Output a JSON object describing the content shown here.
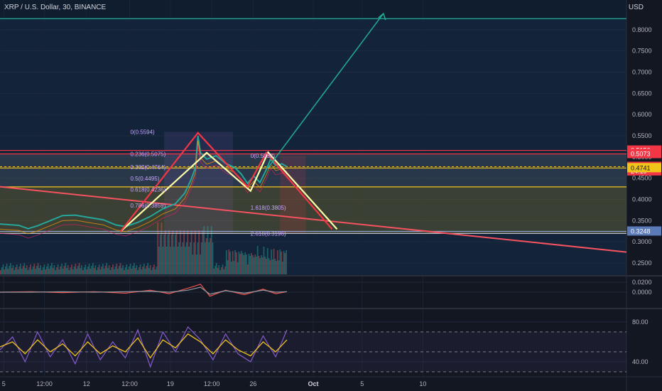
{
  "header": {
    "symbol_line": "XRP / U.S. Dollar, 30, BINANCE",
    "currency": "USD"
  },
  "chart_data": [
    {
      "type": "line",
      "title": "XRP / U.S. Dollar, 30, BINANCE",
      "ylabel": "USD",
      "ylim": [
        0.22,
        0.87
      ],
      "yticks": [
        "0.2500",
        "0.3000",
        "0.3500",
        "0.4000",
        "0.4500",
        "0.5000",
        "0.5500",
        "0.6000",
        "0.6500",
        "0.7000",
        "0.7500",
        "0.8000"
      ],
      "xticks": [
        "5",
        "12:00",
        "12",
        "12:00",
        "19",
        "12:00",
        "26",
        "Oct",
        "5",
        "10"
      ],
      "grid": true,
      "price_labels": [
        {
          "text": "0.5156",
          "value": 0.5156,
          "color": "#f23645"
        },
        {
          "text": "0.5073",
          "value": 0.5073,
          "color": "#f23645"
        },
        {
          "text": "0.4772",
          "value": 0.4772,
          "color": "#f23645"
        },
        {
          "text": "24:19",
          "value": 0.4665,
          "color": "#f23645"
        },
        {
          "text": "0.4741",
          "value": 0.4741,
          "color": "#f0c419"
        },
        {
          "text": "0.3248",
          "value": 0.3248,
          "color": "#5b7ab8"
        }
      ],
      "horizontal_levels": [
        {
          "value": 0.826,
          "color": "#22ab94"
        },
        {
          "value": 0.5156,
          "color": "#f23645"
        },
        {
          "value": 0.5073,
          "color": "#f23645"
        },
        {
          "value": 0.4741,
          "color": "#f0c419"
        },
        {
          "value": 0.4296,
          "color": "#f0c419"
        },
        {
          "value": 0.3248,
          "color": "#8fa8d8"
        },
        {
          "value": 0.32,
          "color": "#d1d4dc"
        }
      ],
      "zones": [
        {
          "from": 0.32,
          "to": 0.4296,
          "color": "#f0c419"
        },
        {
          "from": 0.4296,
          "to": 0.5073,
          "color": "#787b86"
        }
      ],
      "fib_labels": [
        {
          "text": "0(0.5594)",
          "value": 0.5594
        },
        {
          "text": "0.236(0.5075)",
          "value": 0.5075
        },
        {
          "text": "0.382(0.4764)",
          "value": 0.4764
        },
        {
          "text": "0.5(0.4495)",
          "value": 0.4495
        },
        {
          "text": "0.618(0.4236)",
          "value": 0.4236
        },
        {
          "text": "0.786(0.3859)",
          "value": 0.3859
        },
        {
          "text": "0(0.5033)",
          "value": 0.5033
        },
        {
          "text": "1.618(0.3805)",
          "value": 0.3805
        },
        {
          "text": "2.618(0.3196)",
          "value": 0.3196
        }
      ],
      "pattern_lines": [
        {
          "color": "#ffffaa",
          "points": [
            [
              0.192,
              0.324
            ],
            [
              0.33,
              0.51
            ],
            [
              0.4,
              0.42
            ],
            [
              0.428,
              0.511
            ],
            [
              0.538,
              0.33
            ]
          ]
        },
        {
          "color": "#f23645",
          "points": [
            [
              0.192,
              0.324
            ],
            [
              0.316,
              0.557
            ],
            [
              0.395,
              0.43
            ],
            [
              0.425,
              0.51
            ],
            [
              0.53,
              0.33
            ]
          ]
        }
      ],
      "trend_line": {
        "color": "#f7525f",
        "from": [
          0.0,
          0.43
        ],
        "to": [
          1.0,
          0.276
        ]
      },
      "projection_arrow": {
        "color": "#22ab94",
        "from": [
          0.428,
          0.475
        ],
        "to": [
          0.612,
          0.838
        ]
      },
      "series": [
        {
          "name": "price",
          "color": "#26a69a",
          "points": [
            [
              0.0,
              0.342
            ],
            [
              0.03,
              0.339
            ],
            [
              0.045,
              0.331
            ],
            [
              0.06,
              0.338
            ],
            [
              0.08,
              0.35
            ],
            [
              0.1,
              0.362
            ],
            [
              0.12,
              0.363
            ],
            [
              0.14,
              0.358
            ],
            [
              0.165,
              0.352
            ],
            [
              0.185,
              0.34
            ],
            [
              0.2,
              0.336
            ],
            [
              0.22,
              0.346
            ],
            [
              0.24,
              0.36
            ],
            [
              0.26,
              0.378
            ],
            [
              0.28,
              0.39
            ],
            [
              0.295,
              0.415
            ],
            [
              0.305,
              0.447
            ],
            [
              0.312,
              0.475
            ],
            [
              0.316,
              0.55
            ],
            [
              0.32,
              0.51
            ],
            [
              0.33,
              0.495
            ],
            [
              0.345,
              0.503
            ],
            [
              0.36,
              0.485
            ],
            [
              0.375,
              0.475
            ],
            [
              0.385,
              0.46
            ],
            [
              0.395,
              0.438
            ],
            [
              0.405,
              0.455
            ],
            [
              0.415,
              0.44
            ],
            [
              0.425,
              0.47
            ],
            [
              0.432,
              0.495
            ],
            [
              0.44,
              0.48
            ],
            [
              0.45,
              0.484
            ],
            [
              0.458,
              0.4772
            ]
          ]
        }
      ]
    },
    {
      "type": "line",
      "title": "",
      "ylim": [
        -0.03,
        0.03
      ],
      "yticks": [
        "0.0200",
        "0.0000"
      ],
      "series": [
        {
          "name": "osc-a",
          "color": "#ef5350",
          "points": [
            [
              0.0,
              0.0
            ],
            [
              0.05,
              0.001
            ],
            [
              0.1,
              -0.001
            ],
            [
              0.15,
              0.001
            ],
            [
              0.2,
              -0.002
            ],
            [
              0.24,
              0.004
            ],
            [
              0.27,
              -0.003
            ],
            [
              0.3,
              0.008
            ],
            [
              0.32,
              0.016
            ],
            [
              0.335,
              -0.008
            ],
            [
              0.36,
              0.004
            ],
            [
              0.39,
              -0.005
            ],
            [
              0.42,
              0.006
            ],
            [
              0.44,
              -0.003
            ],
            [
              0.458,
              0.001
            ]
          ]
        },
        {
          "name": "osc-b",
          "color": "#9598a1",
          "points": [
            [
              0.0,
              0.0
            ],
            [
              0.05,
              0.0
            ],
            [
              0.1,
              0.001
            ],
            [
              0.15,
              0.0
            ],
            [
              0.2,
              0.001
            ],
            [
              0.24,
              0.002
            ],
            [
              0.27,
              0.0
            ],
            [
              0.3,
              0.004
            ],
            [
              0.32,
              0.01
            ],
            [
              0.335,
              -0.004
            ],
            [
              0.36,
              0.003
            ],
            [
              0.39,
              -0.002
            ],
            [
              0.42,
              0.004
            ],
            [
              0.44,
              0.0
            ],
            [
              0.458,
              0.001
            ]
          ]
        }
      ]
    },
    {
      "type": "line",
      "title": "",
      "ylim": [
        25,
        92
      ],
      "yticks": [
        "80.00",
        "40.00"
      ],
      "series": [
        {
          "name": "osc-c",
          "color": "#7e57c2",
          "points": [
            [
              0.0,
              52
            ],
            [
              0.02,
              65
            ],
            [
              0.04,
              40
            ],
            [
              0.06,
              70
            ],
            [
              0.08,
              45
            ],
            [
              0.1,
              62
            ],
            [
              0.12,
              38
            ],
            [
              0.14,
              68
            ],
            [
              0.16,
              42
            ],
            [
              0.18,
              60
            ],
            [
              0.2,
              44
            ],
            [
              0.22,
              72
            ],
            [
              0.24,
              35
            ],
            [
              0.26,
              70
            ],
            [
              0.28,
              50
            ],
            [
              0.3,
              75
            ],
            [
              0.32,
              62
            ],
            [
              0.34,
              42
            ],
            [
              0.36,
              68
            ],
            [
              0.38,
              48
            ],
            [
              0.4,
              40
            ],
            [
              0.42,
              66
            ],
            [
              0.44,
              45
            ],
            [
              0.458,
              72
            ]
          ]
        },
        {
          "name": "osc-d",
          "color": "#f0c419",
          "points": [
            [
              0.0,
              55
            ],
            [
              0.02,
              60
            ],
            [
              0.04,
              48
            ],
            [
              0.06,
              62
            ],
            [
              0.08,
              50
            ],
            [
              0.1,
              58
            ],
            [
              0.12,
              46
            ],
            [
              0.14,
              60
            ],
            [
              0.16,
              48
            ],
            [
              0.18,
              56
            ],
            [
              0.2,
              50
            ],
            [
              0.22,
              64
            ],
            [
              0.24,
              44
            ],
            [
              0.26,
              62
            ],
            [
              0.28,
              54
            ],
            [
              0.3,
              68
            ],
            [
              0.32,
              60
            ],
            [
              0.34,
              48
            ],
            [
              0.36,
              62
            ],
            [
              0.38,
              52
            ],
            [
              0.4,
              46
            ],
            [
              0.42,
              60
            ],
            [
              0.44,
              50
            ],
            [
              0.458,
              62
            ]
          ]
        }
      ]
    }
  ]
}
